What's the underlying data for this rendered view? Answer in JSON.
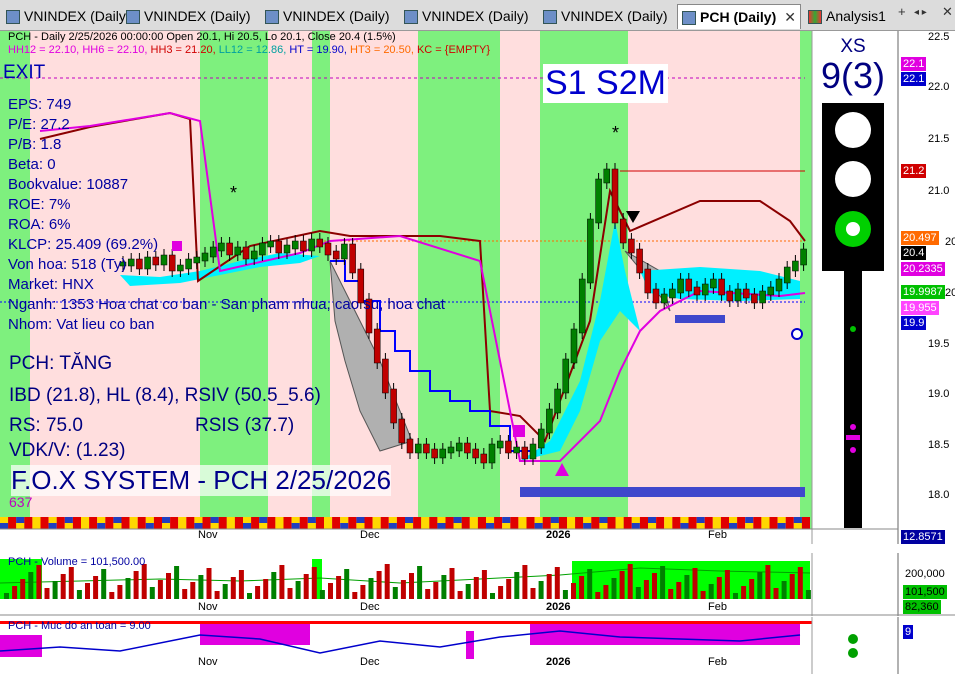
{
  "tabs": [
    {
      "label": "VNINDEX (Daily)"
    },
    {
      "label": "VNINDEX (Daily)"
    },
    {
      "label": "VNINDEX (Daily)"
    },
    {
      "label": "VNINDEX (Daily)"
    },
    {
      "label": "VNINDEX (Daily)"
    },
    {
      "label": "PCH (Daily)",
      "close": "✕"
    },
    {
      "label": "Analysis1"
    }
  ],
  "toolbar": {
    "add": "+",
    "nav": "◂ ▸",
    "close": "✕"
  },
  "header": {
    "title": "PCH - Daily 2/25/2026 00:00:00 Open 20.1, Hi 20.5, Lo 20.1, Close 20.4 (1.5%)",
    "hh12": "HH12 = 22.10,",
    "hh6": "HH6 = 22.10,",
    "hh3": "HH3 = 21.20,",
    "ll12": "LL12 = 12.86,",
    "ht": "HT = 19.90,",
    "ht3": "HT3 = 20.50,",
    "kc": "KC = {EMPTY}"
  },
  "exit_label": "EXIT",
  "info": [
    "EPS: 749",
    "P/E: 27.2",
    "P/B: 1.8",
    "Beta: 0",
    "Bookvalue: 10887",
    "ROE: 7%",
    "ROA: 6%",
    "KLCP: 25.409 (69.2%)",
    "Von hoa: 518 (Ty)",
    "Market: HNX",
    "Nganh: 1353 Hoa chat co ban - San pham nhua, cao su, hoa chat",
    "Nhom: Vat lieu co ban"
  ],
  "signal": {
    "status": "PCH: TĂNG",
    "ibd": "IBD (21.8), HL (8.4), RSIV (50.5_5.6)",
    "rs": "RS: 75.0",
    "rsis": "RSIS (37.7)",
    "vdk": "VDK/V:  (1.23)"
  },
  "fox": "F.O.X SYSTEM - PCH 2/25/2026",
  "count": "637",
  "signal_tag": "S1  S2M",
  "xs": {
    "label": "XS",
    "value": "9(3)"
  },
  "price_axis": [
    "22.5",
    "22.0",
    "21.5",
    "21.0",
    "20.5",
    "20.0",
    "19.5",
    "19.0",
    "18.5",
    "18.0"
  ],
  "price_boxes": [
    {
      "text": "22.1",
      "bg": "#e000e0",
      "fg": "#ffffff"
    },
    {
      "text": "22.1",
      "bg": "#0000cc",
      "fg": "#ffffff"
    },
    {
      "text": "21.2",
      "bg": "#d00000",
      "fg": "#ffffff"
    },
    {
      "text": "20.497",
      "bg": "#ff6a00",
      "fg": "#ffffff"
    },
    {
      "text": "20.4",
      "bg": "#000000",
      "fg": "#ffffff"
    },
    {
      "text": "20.2335",
      "bg": "#e000e0",
      "fg": "#ffffff"
    },
    {
      "text": "19.9987",
      "bg": "#00c000",
      "fg": "#ffffff"
    },
    {
      "text": "19.955",
      "bg": "#ff44ff",
      "fg": "#ffffff"
    },
    {
      "text": "19.9",
      "bg": "#0000cc",
      "fg": "#ffffff"
    },
    {
      "text": "12.8571",
      "bg": "#0000a0",
      "fg": "#ffffff"
    }
  ],
  "x_axis": [
    "Nov",
    "Dec",
    "2026",
    "Feb"
  ],
  "volume": {
    "title": "PCH - Volume = 101,500.00",
    "axis_top": "200,000",
    "box1": "101,500",
    "box2": "82,360"
  },
  "safety": {
    "title": "PCH - Muc do an toan = 9.00",
    "box": "9"
  },
  "colors": {
    "green_band": "#7ef07e",
    "pink_band": "#ffdede",
    "candle_up": "#008000",
    "candle_down": "#c00000",
    "cyan": "#00f0ff"
  }
}
